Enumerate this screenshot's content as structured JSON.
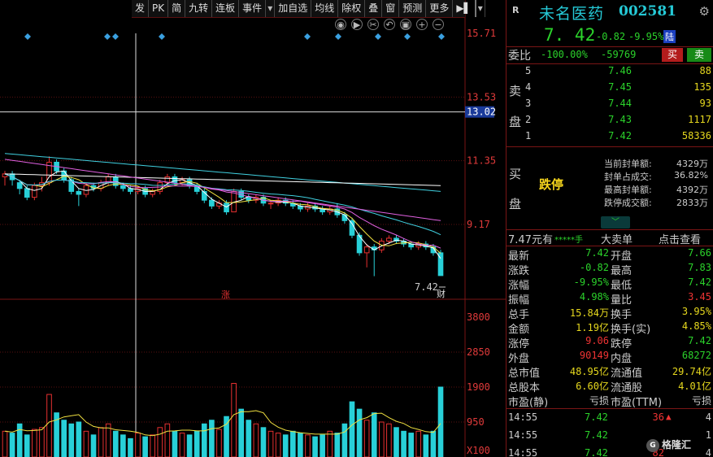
{
  "toolbar": {
    "items": [
      "发",
      "PK",
      "简",
      "九转",
      "连板",
      "事件",
      "",
      "加自选",
      "均线",
      "除权",
      "叠",
      "窗",
      "预测",
      "更多"
    ],
    "dropdown": "▾",
    "arrow": "▶▌"
  },
  "tool_icons": [
    "eye-icon",
    "play-icon",
    "scissors-icon",
    "undo-icon",
    "lock-icon",
    "zoom-in-icon",
    "zoom-out-icon"
  ],
  "chart": {
    "price_axis_ticks": [
      "15.71",
      "13.53",
      "11.35",
      "9.17"
    ],
    "crosshair_price": "13.02",
    "last_price_label": "7.42",
    "rise_marker": "涨",
    "finance_marker": "财",
    "volume_axis_ticks": [
      "3800",
      "2850",
      "1900",
      "950"
    ],
    "volume_unit": "X100"
  },
  "chart_data": {
    "type": "candlestick",
    "price_ylim": [
      7.4,
      15.71
    ],
    "volume_ylim": [
      0,
      3800
    ],
    "ma_colors": [
      "#ffffff",
      "#f0e040",
      "#e060e0",
      "#40d0e0"
    ],
    "up_color": "#e53030",
    "down_color": "#28d0d8",
    "candles": [
      [
        10.8,
        10.9,
        10.5,
        11.0
      ],
      [
        10.9,
        10.7,
        10.5,
        11.0
      ],
      [
        10.6,
        10.4,
        10.2,
        10.7
      ],
      [
        10.4,
        10.1,
        10.0,
        10.5
      ],
      [
        10.1,
        10.5,
        10.0,
        10.6
      ],
      [
        10.5,
        10.6,
        10.3,
        10.8
      ],
      [
        10.6,
        11.3,
        10.5,
        11.5
      ],
      [
        11.3,
        11.0,
        10.9,
        11.4
      ],
      [
        11.0,
        10.7,
        10.6,
        11.1
      ],
      [
        10.7,
        10.3,
        10.2,
        10.8
      ],
      [
        10.3,
        10.2,
        9.8,
        10.4
      ],
      [
        10.2,
        10.5,
        10.1,
        10.6
      ],
      [
        10.5,
        10.4,
        10.3,
        10.6
      ],
      [
        10.4,
        10.6,
        10.3,
        10.7
      ],
      [
        10.6,
        10.8,
        10.5,
        10.9
      ],
      [
        10.8,
        10.5,
        10.4,
        10.9
      ],
      [
        10.5,
        10.4,
        10.3,
        10.6
      ],
      [
        10.4,
        10.3,
        10.2,
        10.5
      ],
      [
        10.3,
        10.4,
        10.2,
        10.5
      ],
      [
        10.4,
        10.2,
        10.1,
        10.5
      ],
      [
        10.2,
        10.3,
        10.1,
        10.4
      ],
      [
        10.3,
        10.6,
        10.2,
        10.7
      ],
      [
        10.6,
        10.8,
        10.5,
        10.9
      ],
      [
        10.8,
        10.6,
        10.5,
        10.9
      ],
      [
        10.6,
        10.7,
        10.5,
        10.8
      ],
      [
        10.7,
        10.5,
        10.4,
        10.8
      ],
      [
        10.5,
        10.3,
        10.2,
        10.6
      ],
      [
        10.3,
        10.0,
        9.9,
        10.4
      ],
      [
        10.0,
        9.8,
        9.7,
        10.1
      ],
      [
        9.8,
        9.9,
        9.7,
        10.0
      ],
      [
        9.9,
        9.6,
        9.5,
        10.0
      ],
      [
        9.6,
        10.3,
        9.6,
        10.4
      ],
      [
        10.3,
        10.1,
        10.0,
        10.4
      ],
      [
        10.1,
        10.0,
        9.9,
        10.2
      ],
      [
        10.0,
        10.1,
        9.9,
        10.2
      ],
      [
        10.1,
        9.9,
        9.8,
        10.2
      ],
      [
        9.9,
        9.9,
        9.7,
        10.0
      ],
      [
        9.9,
        10.0,
        9.8,
        10.1
      ],
      [
        10.0,
        9.9,
        9.8,
        10.1
      ],
      [
        9.9,
        9.8,
        9.7,
        10.0
      ],
      [
        9.8,
        9.7,
        9.6,
        9.9
      ],
      [
        9.7,
        9.8,
        9.6,
        9.9
      ],
      [
        9.8,
        9.7,
        9.6,
        9.9
      ],
      [
        9.7,
        9.6,
        9.5,
        9.8
      ],
      [
        9.6,
        9.7,
        9.5,
        9.8
      ],
      [
        9.7,
        9.5,
        9.4,
        9.9
      ],
      [
        9.5,
        9.3,
        9.2,
        9.6
      ],
      [
        9.3,
        8.8,
        8.7,
        9.4
      ],
      [
        8.8,
        8.2,
        8.1,
        8.9
      ],
      [
        8.2,
        8.4,
        7.7,
        8.5
      ],
      [
        8.4,
        8.3,
        7.4,
        8.5
      ],
      [
        8.3,
        8.6,
        8.2,
        8.7
      ],
      [
        8.6,
        8.7,
        8.5,
        8.8
      ],
      [
        8.7,
        8.6,
        8.5,
        8.8
      ],
      [
        8.6,
        8.5,
        8.4,
        8.7
      ],
      [
        8.5,
        8.4,
        8.3,
        8.6
      ],
      [
        8.4,
        8.5,
        8.3,
        8.6
      ],
      [
        8.5,
        8.4,
        8.3,
        8.6
      ],
      [
        8.4,
        8.2,
        8.1,
        8.5
      ],
      [
        8.2,
        7.42,
        7.42,
        8.3
      ]
    ],
    "volumes": [
      700,
      650,
      900,
      600,
      750,
      800,
      1700,
      1200,
      1000,
      900,
      950,
      700,
      600,
      800,
      900,
      700,
      600,
      500,
      650,
      550,
      600,
      800,
      900,
      700,
      650,
      600,
      700,
      900,
      1000,
      750,
      1100,
      2000,
      1300,
      1000,
      900,
      800,
      700,
      650,
      600,
      700,
      650,
      600,
      550,
      600,
      700,
      650,
      900,
      1500,
      1300,
      1000,
      1200,
      950,
      900,
      800,
      700,
      650,
      700,
      600,
      700,
      1900
    ]
  },
  "right_panel": {
    "r_label": "R",
    "stock_name": "未名医药",
    "stock_code": "002581",
    "price": "7. 42",
    "change": "-0.82",
    "change_pct": "-9.95%",
    "exchange_badge": "陆",
    "weibi_label": "委比",
    "weibi_pct": "-100.00%",
    "weibi_diff": "-59769",
    "buy_button": "买",
    "sell_button": "卖",
    "sell_side_label": [
      "卖",
      "盘"
    ],
    "buy_side_label": [
      "买",
      "盘"
    ],
    "asks": [
      {
        "level": "5",
        "price": "7.46",
        "volume": "88"
      },
      {
        "level": "4",
        "price": "7.45",
        "volume": "135"
      },
      {
        "level": "3",
        "price": "7.44",
        "volume": "93"
      },
      {
        "level": "2",
        "price": "7.43",
        "volume": "1117"
      },
      {
        "level": "1",
        "price": "7.42",
        "volume": "58336"
      }
    ],
    "limit_down_label": "跌停",
    "seal": [
      {
        "k": "当前封单额:",
        "v": "4329万"
      },
      {
        "k": "封单占成交:",
        "v": "36.82%"
      },
      {
        "k": "最高封单额:",
        "v": "4392万"
      },
      {
        "k": "跌停成交额:",
        "v": "2833万"
      }
    ],
    "expand_icon": "chevron-down-icon",
    "tab_price": "7.47",
    "tab_price_unit": "元有",
    "tab_stars": "*****手",
    "tab_big_orders": "大卖单",
    "tab_detail": "点击查看",
    "quotes": [
      {
        "k1": "最新",
        "v1": "7.42",
        "c1": "#2bd22b",
        "k2": "开盘",
        "v2": "7.66",
        "c2": "#2bd22b"
      },
      {
        "k1": "涨跌",
        "v1": "-0.82",
        "c1": "#2bd22b",
        "k2": "最高",
        "v2": "7.83",
        "c2": "#2bd22b"
      },
      {
        "k1": "涨幅",
        "v1": "-9.95%",
        "c1": "#2bd22b",
        "k2": "最低",
        "v2": "7.42",
        "c2": "#2bd22b"
      },
      {
        "k1": "振幅",
        "v1": "4.98%",
        "c1": "#2bd22b",
        "k2": "量比",
        "v2": "3.45",
        "c2": "#e33"
      },
      {
        "k1": "总手",
        "v1": "15.84",
        "u1": "万",
        "c1": "#e6d81e",
        "k2": "换手",
        "v2": "3.95%",
        "c2": "#e6d81e"
      },
      {
        "k1": "金额",
        "v1": "1.19",
        "u1": "亿",
        "c1": "#e6d81e",
        "k2": "换手(实)",
        "v2": "4.85%",
        "c2": "#e6d81e"
      },
      {
        "k1": "涨停",
        "v1": "9.06",
        "c1": "#e33",
        "k2": "跌停",
        "v2": "7.42",
        "c2": "#2bd22b"
      },
      {
        "k1": "外盘",
        "v1": "90149",
        "c1": "#e33",
        "k2": "内盘",
        "v2": "68272",
        "c2": "#2bd22b"
      },
      {
        "k1": "总市值",
        "v1": "48.95",
        "u1": "亿",
        "c1": "#e6d81e",
        "k2": "流通值",
        "v2": "29.74",
        "u2": "亿",
        "c2": "#e6d81e"
      },
      {
        "k1": "总股本",
        "v1": "6.60",
        "u1": "亿",
        "c1": "#e6d81e",
        "k2": "流通股",
        "v2": "4.01",
        "u2": "亿",
        "c2": "#e6d81e"
      },
      {
        "k1": "市盈(静)",
        "v1": "亏损",
        "c1": "#ccc",
        "k2": "市盈(TTM)",
        "v2": "亏损",
        "c2": "#ccc"
      }
    ],
    "ticks": [
      {
        "time": "14:55",
        "price": "7.42",
        "vol": "36",
        "arrow": "▲",
        "n": "4"
      },
      {
        "time": "14:55",
        "price": "7.42",
        "vol": "",
        "arrow": "",
        "n": "1"
      },
      {
        "time": "14:55",
        "price": "7.42",
        "vol": "82",
        "arrow": "",
        "n": "4"
      }
    ],
    "watermark": "格隆汇",
    "watermark_logo": "G"
  }
}
